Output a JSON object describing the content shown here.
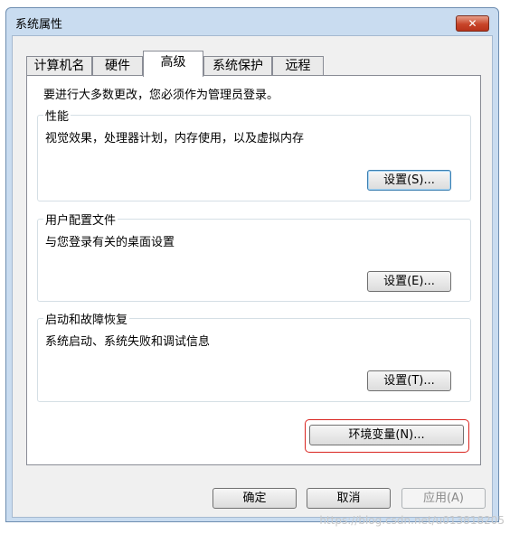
{
  "window": {
    "title": "系统属性",
    "close_label": "✕"
  },
  "tabs": [
    {
      "label": "计算机名"
    },
    {
      "label": "硬件"
    },
    {
      "label": "高级"
    },
    {
      "label": "系统保护"
    },
    {
      "label": "远程"
    }
  ],
  "panel": {
    "intro": "要进行大多数更改，您必须作为管理员登录。",
    "performance": {
      "label": "性能",
      "desc": "视觉效果，处理器计划，内存使用，以及虚拟内存",
      "button": "设置(S)..."
    },
    "user_profiles": {
      "label": "用户配置文件",
      "desc": "与您登录有关的桌面设置",
      "button": "设置(E)..."
    },
    "startup_recovery": {
      "label": "启动和故障恢复",
      "desc": "系统启动、系统失败和调试信息",
      "button": "设置(T)..."
    },
    "env_button": "环境变量(N)..."
  },
  "footer": {
    "ok": "确定",
    "cancel": "取消",
    "apply": "应用(A)"
  },
  "watermark": "https://blog.csdn.net/u013818205"
}
